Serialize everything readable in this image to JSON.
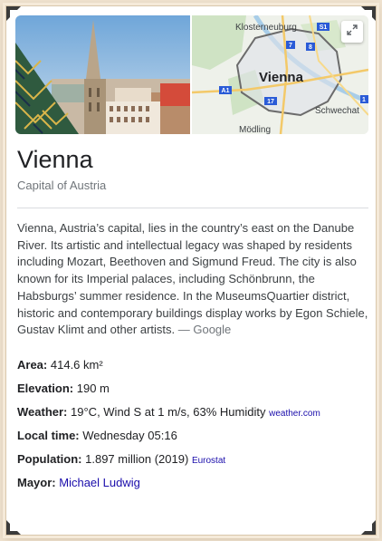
{
  "place": {
    "title": "Vienna",
    "subtitle": "Capital of Austria"
  },
  "map": {
    "labels": {
      "klosterneuburg": "Klosterneuburg",
      "vienna": "Vienna",
      "schwechat": "Schwechat",
      "modling": "Mödling"
    },
    "shields": [
      "S1",
      "7",
      "8",
      "A1",
      "17",
      "1"
    ]
  },
  "description": {
    "text": "Vienna, Austria’s capital, lies in the country’s east on the Danube River. Its artistic and intellectual legacy was shaped by residents including Mozart, Beethoven and Sigmund Freud. The city is also known for its Imperial palaces, including Schönbrunn, the Habsburgs’ summer residence. In the MuseumsQuartier district, historic and contemporary buildings display works by Egon Schiele, Gustav Klimt and other artists.",
    "source": "— Google"
  },
  "facts": {
    "area": {
      "label": "Area:",
      "value": "414.6 km²"
    },
    "elevation": {
      "label": "Elevation:",
      "value": "190 m"
    },
    "weather": {
      "label": "Weather:",
      "value": "19°C, Wind S at 1 m/s, 63% Humidity",
      "source": "weather.com"
    },
    "local_time": {
      "label": "Local time:",
      "value": "Wednesday 05:16"
    },
    "population": {
      "label": "Population:",
      "value": "1.897 million (2019)",
      "source": "Eurostat"
    },
    "mayor": {
      "label": "Mayor:",
      "value": "Michael Ludwig"
    }
  },
  "colors": {
    "link": "#1a0dab",
    "title": "#202124",
    "muted": "#70757a",
    "frame_bg": "#efe2cf"
  }
}
